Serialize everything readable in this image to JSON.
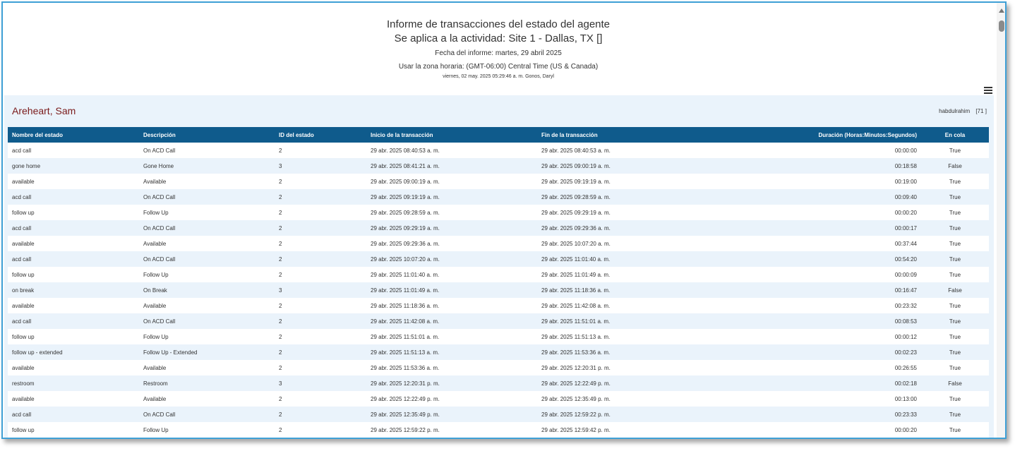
{
  "header": {
    "title": "Informe de transacciones del estado del agente",
    "subtitle": "Se aplica a la actividad: Site 1 - Dallas, TX []",
    "report_date": "Fecha del informe: martes, 29 abril 2025",
    "timezone": "Usar la zona horaria: (GMT-06:00) Central Time (US & Canada)",
    "generated": "viernes, 02 may. 2025 05:29:46 a. m. Gonos, Daryl"
  },
  "icons": {
    "menu": "hamburger-menu-icon",
    "scroll_up": "arrow-up-icon"
  },
  "colors": {
    "header_row": "#0f5b8c",
    "agent_name": "#7a1a1a",
    "alt_row": "#eaf3fb"
  },
  "agent": {
    "name": "Areheart, Sam",
    "username": "habdulrahim",
    "id": "[71 ]"
  },
  "table": {
    "columns": [
      "Nombre del estado",
      "Descripción",
      "ID del estado",
      "Inicio de la transacción",
      "Fin de la transacción",
      "Duración (Horas:Minutos:Segundos)",
      "En cola"
    ],
    "rows": [
      [
        "acd call",
        "On ACD Call",
        "2",
        "29 abr. 2025 08:40:53 a. m.",
        "29 abr. 2025 08:40:53 a. m.",
        "00:00:00",
        "True"
      ],
      [
        "gone home",
        "Gone Home",
        "3",
        "29 abr. 2025 08:41:21 a. m.",
        "29 abr. 2025 09:00:19 a. m.",
        "00:18:58",
        "False"
      ],
      [
        "available",
        "Available",
        "2",
        "29 abr. 2025 09:00:19 a. m.",
        "29 abr. 2025 09:19:19 a. m.",
        "00:19:00",
        "True"
      ],
      [
        "acd call",
        "On ACD Call",
        "2",
        "29 abr. 2025 09:19:19 a. m.",
        "29 abr. 2025 09:28:59 a. m.",
        "00:09:40",
        "True"
      ],
      [
        "follow up",
        "Follow Up",
        "2",
        "29 abr. 2025 09:28:59 a. m.",
        "29 abr. 2025 09:29:19 a. m.",
        "00:00:20",
        "True"
      ],
      [
        "acd call",
        "On ACD Call",
        "2",
        "29 abr. 2025 09:29:19 a. m.",
        "29 abr. 2025 09:29:36 a. m.",
        "00:00:17",
        "True"
      ],
      [
        "available",
        "Available",
        "2",
        "29 abr. 2025 09:29:36 a. m.",
        "29 abr. 2025 10:07:20 a. m.",
        "00:37:44",
        "True"
      ],
      [
        "acd call",
        "On ACD Call",
        "2",
        "29 abr. 2025 10:07:20 a. m.",
        "29 abr. 2025 11:01:40 a. m.",
        "00:54:20",
        "True"
      ],
      [
        "follow up",
        "Follow Up",
        "2",
        "29 abr. 2025 11:01:40 a. m.",
        "29 abr. 2025 11:01:49 a. m.",
        "00:00:09",
        "True"
      ],
      [
        "on break",
        "On Break",
        "3",
        "29 abr. 2025 11:01:49 a. m.",
        "29 abr. 2025 11:18:36 a. m.",
        "00:16:47",
        "False"
      ],
      [
        "available",
        "Available",
        "2",
        "29 abr. 2025 11:18:36 a. m.",
        "29 abr. 2025 11:42:08 a. m.",
        "00:23:32",
        "True"
      ],
      [
        "acd call",
        "On ACD Call",
        "2",
        "29 abr. 2025 11:42:08 a. m.",
        "29 abr. 2025 11:51:01 a. m.",
        "00:08:53",
        "True"
      ],
      [
        "follow up",
        "Follow Up",
        "2",
        "29 abr. 2025 11:51:01 a. m.",
        "29 abr. 2025 11:51:13 a. m.",
        "00:00:12",
        "True"
      ],
      [
        "follow up - extended",
        "Follow Up - Extended",
        "2",
        "29 abr. 2025 11:51:13 a. m.",
        "29 abr. 2025 11:53:36 a. m.",
        "00:02:23",
        "True"
      ],
      [
        "available",
        "Available",
        "2",
        "29 abr. 2025 11:53:36 a. m.",
        "29 abr. 2025 12:20:31 p. m.",
        "00:26:55",
        "True"
      ],
      [
        "restroom",
        "Restroom",
        "3",
        "29 abr. 2025 12:20:31 p. m.",
        "29 abr. 2025 12:22:49 p. m.",
        "00:02:18",
        "False"
      ],
      [
        "available",
        "Available",
        "2",
        "29 abr. 2025 12:22:49 p. m.",
        "29 abr. 2025 12:35:49 p. m.",
        "00:13:00",
        "True"
      ],
      [
        "acd call",
        "On ACD Call",
        "2",
        "29 abr. 2025 12:35:49 p. m.",
        "29 abr. 2025 12:59:22 p. m.",
        "00:23:33",
        "True"
      ],
      [
        "follow up",
        "Follow Up",
        "2",
        "29 abr. 2025 12:59:22 p. m.",
        "29 abr. 2025 12:59:42 p. m.",
        "00:00:20",
        "True"
      ]
    ]
  }
}
